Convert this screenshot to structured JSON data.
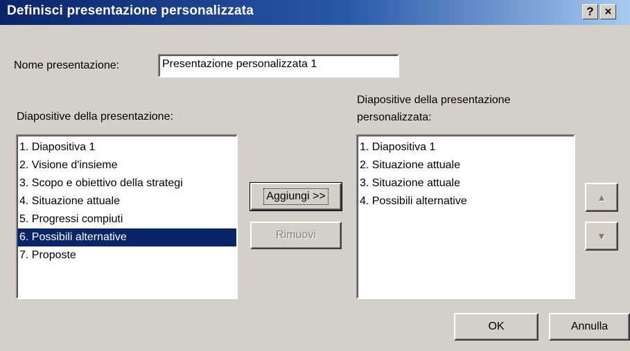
{
  "window": {
    "title": "Definisci presentazione personalizzata",
    "help_label": "?",
    "close_label": "×"
  },
  "name_field": {
    "label": "Nome presentazione:",
    "value": "Presentazione personalizzata 1"
  },
  "left_list": {
    "label": "Diapositive della presentazione:",
    "items": [
      "1. Diapositiva 1",
      "2. Visione d'insieme",
      "3. Scopo e obiettivo della strategi",
      "4. Situazione attuale",
      "5. Progressi compiuti",
      "6. Possibili alternative",
      "7. Proposte"
    ],
    "selected_index": 5
  },
  "right_list": {
    "label_line1": "Diapositive della presentazione",
    "label_line2": "personalizzata:",
    "items": [
      "1. Diapositiva 1",
      "2. Situazione attuale",
      "3. Situazione attuale",
      "4. Possibili alternative"
    ]
  },
  "buttons": {
    "add": "Aggiungi >>",
    "remove": "Rimuovi",
    "move_up": "▲",
    "move_down": "▼",
    "ok": "OK",
    "cancel": "Annulla"
  }
}
